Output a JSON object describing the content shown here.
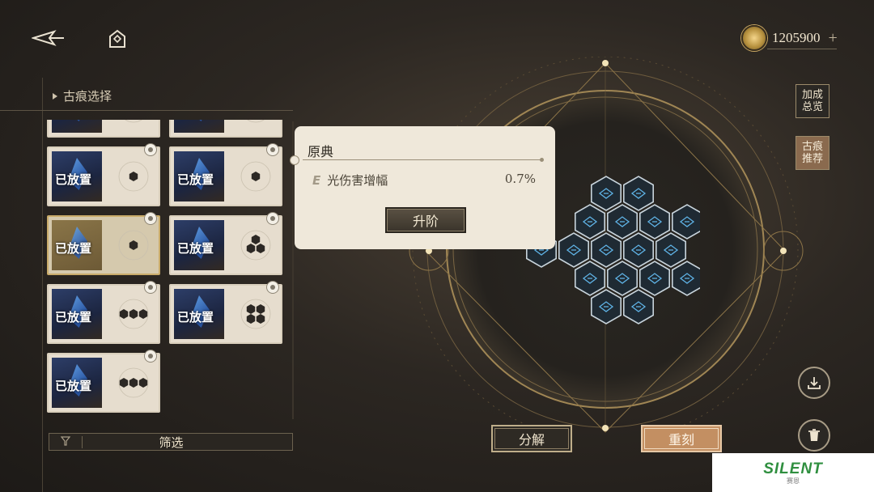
{
  "header": {
    "back_icon": "back-arrow-icon",
    "home_icon": "home-icon",
    "currency": {
      "icon": "coin-icon",
      "amount": "1205900",
      "add_symbol": "+"
    }
  },
  "panel": {
    "title": "古痕选择",
    "cards": [
      {
        "label": "已放置",
        "slots": 1,
        "selected": false,
        "locked": false
      },
      {
        "label": "已放置",
        "slots": 1,
        "selected": false,
        "locked": false
      },
      {
        "label": "已放置",
        "slots": 1,
        "selected": false,
        "locked": true
      },
      {
        "label": "已放置",
        "slots": 1,
        "selected": false,
        "locked": true
      },
      {
        "label": "已放置",
        "slots": 1,
        "selected": true,
        "locked": true
      },
      {
        "label": "已放置",
        "slots": 3,
        "selected": false,
        "locked": true
      },
      {
        "label": "已放置",
        "slots": 3,
        "selected": false,
        "locked": true
      },
      {
        "label": "已放置",
        "slots": 4,
        "selected": false,
        "locked": true
      },
      {
        "label": "已放置",
        "slots": 3,
        "selected": false,
        "locked": true
      }
    ],
    "filter_label": "筛选"
  },
  "popup": {
    "title": "原典",
    "stat_icon": "E",
    "stat_name": "光伤害增幅",
    "stat_value": "0.7%",
    "upgrade_label": "升阶"
  },
  "right_side": {
    "bonus_overview": "加成总览",
    "recommend": "古痕推荐",
    "save_icon": "download-icon",
    "delete_icon": "trash-icon"
  },
  "bottom": {
    "decompose_label": "分解",
    "reforge_label": "重刻"
  },
  "watermark": {
    "text": "SILENT",
    "sub": "赛恩"
  },
  "colors": {
    "accent_gold": "#c9a863",
    "reforge_bg": "#c38f62",
    "panel_bg": "#efe8da"
  }
}
